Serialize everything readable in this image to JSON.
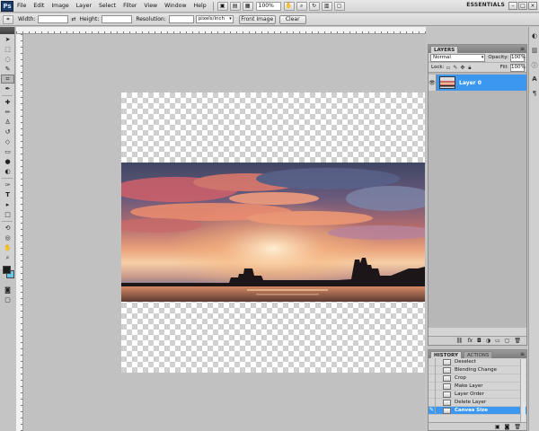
{
  "app": {
    "logo": "Ps",
    "menu": [
      "File",
      "Edit",
      "Image",
      "Layer",
      "Select",
      "Filter",
      "View",
      "Window",
      "Help"
    ],
    "zoom": "100%",
    "workspace": "ESSENTIALS"
  },
  "options_bar": {
    "width_label": "Width:",
    "height_label": "Height:",
    "resolution_label": "Resolution:",
    "resolution_unit": "pixels/inch",
    "front_image_button": "Front Image",
    "clear_button": "Clear"
  },
  "colors": {
    "foreground": "#1d1d1d",
    "background": "#69c6e8",
    "selection": "#3b97f0"
  },
  "layers_panel": {
    "tab": "LAYERS",
    "blend_mode": "Normal",
    "opacity_label": "Opacity:",
    "opacity": "100%",
    "lock_label": "Lock:",
    "fill_label": "Fill:",
    "fill": "100%",
    "layers": [
      {
        "name": "Layer 0",
        "visible": true,
        "selected": true
      }
    ],
    "footer_icons": [
      "link-icon",
      "fx-icon",
      "mask-icon",
      "adjustment-icon",
      "group-icon",
      "new-layer-icon",
      "trash-icon"
    ]
  },
  "history_panel": {
    "tabs": [
      "HISTORY",
      "ACTIONS"
    ],
    "items": [
      {
        "label": "Deselect"
      },
      {
        "label": "Blending Change"
      },
      {
        "label": "Crop"
      },
      {
        "label": "Make Layer"
      },
      {
        "label": "Layer Order"
      },
      {
        "label": "Delete Layer"
      },
      {
        "label": "Canvas Size",
        "selected": true
      }
    ]
  }
}
